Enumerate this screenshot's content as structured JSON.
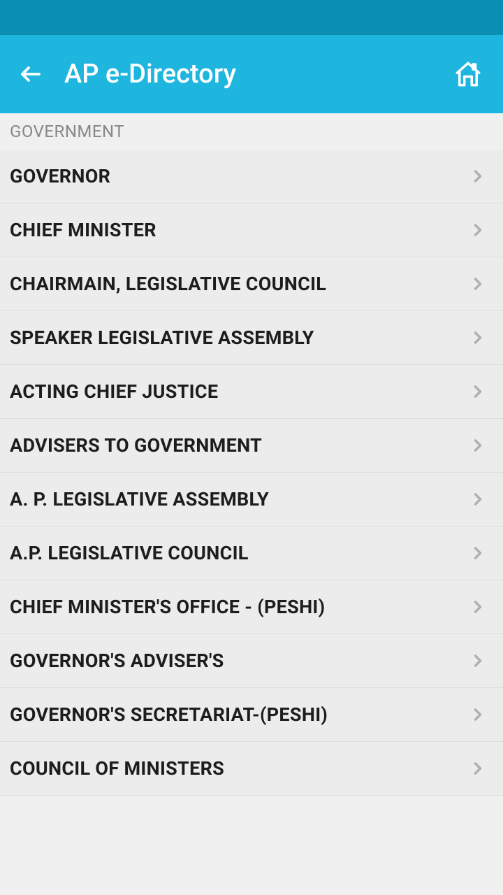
{
  "header": {
    "title": "AP e-Directory"
  },
  "section": {
    "label": "GOVERNMENT"
  },
  "items": [
    {
      "label": "GOVERNOR"
    },
    {
      "label": "CHIEF MINISTER"
    },
    {
      "label": "CHAIRMAIN, LEGISLATIVE COUNCIL"
    },
    {
      "label": "SPEAKER LEGISLATIVE ASSEMBLY"
    },
    {
      "label": "ACTING CHIEF  JUSTICE"
    },
    {
      "label": "ADVISERS TO GOVERNMENT"
    },
    {
      "label": "A. P. LEGISLATIVE  ASSEMBLY"
    },
    {
      "label": "A.P. LEGISLATIVE COUNCIL"
    },
    {
      "label": "CHIEF MINISTER'S OFFICE - (PESHI)"
    },
    {
      "label": "GOVERNOR'S ADVISER'S"
    },
    {
      "label": "GOVERNOR'S SECRETARIAT-(PESHI)"
    },
    {
      "label": "COUNCIL OF MINISTERS"
    }
  ]
}
